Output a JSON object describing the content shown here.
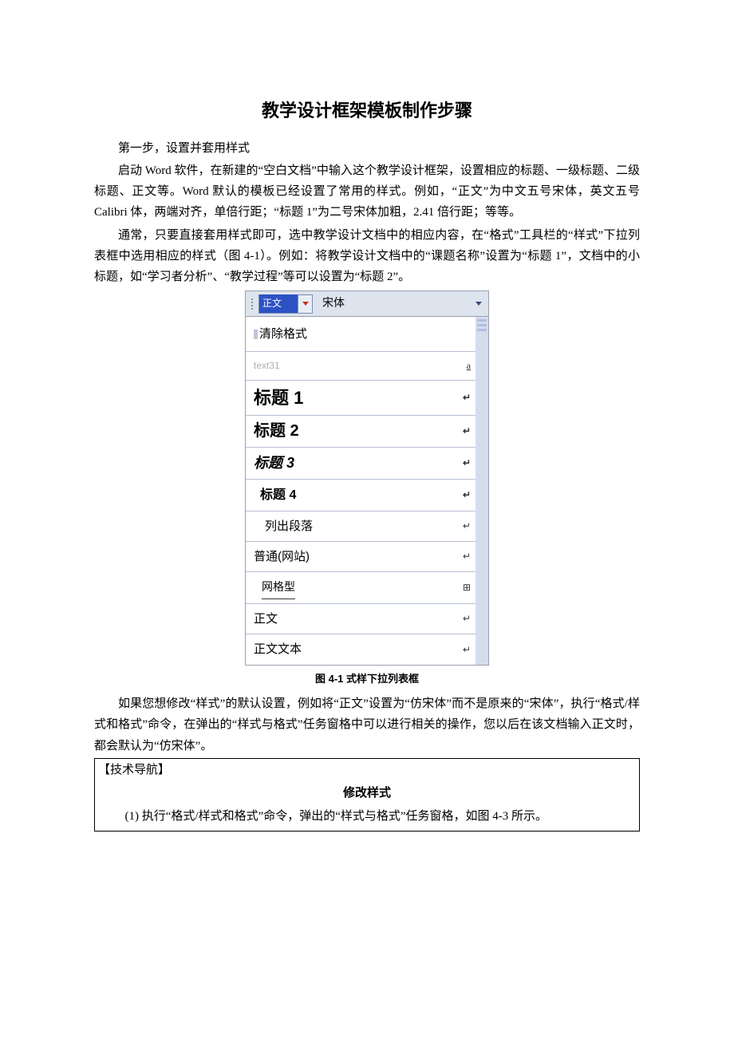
{
  "title": "教学设计框架模板制作步骤",
  "step1_label": "第一步，设置并套用样式",
  "para1": "启动 Word 软件，在新建的“空白文档”中输入这个教学设计框架，设置相应的标题、一级标题、二级标题、正文等。Word 默认的模板已经设置了常用的样式。例如，“正文”为中文五号宋体，英文五号 Calibri 体，两端对齐，单倍行距；“标题 1”为二号宋体加粗，2.41 倍行距；等等。",
  "para2": "通常，只要直接套用样式即可，选中教学设计文档中的相应内容，在“格式”工具栏的“样式”下拉列表框中选用相应的样式（图 4-1）。例如：将教学设计文档中的“课题名称”设置为“标题 1”，文档中的小标题，如“学习者分析”、“教学过程”等可以设置为“标题 2”。",
  "figure": {
    "toolbar": {
      "selected_style": "正文",
      "font_label": "宋体"
    },
    "items": {
      "clear": "清除格式",
      "text31": "text31",
      "text31_mark": "a",
      "h1": "标题 1",
      "h2": "标题 2",
      "h3": "标题 3",
      "h4": "标题 4",
      "list": "列出段落",
      "web": "普通(网站)",
      "grid": "网格型",
      "body": "正文",
      "bodytext": "正文文本"
    },
    "para_mark": "↵",
    "grid_mark": "⊞",
    "caption": "图 4-1  式样下拉列表框"
  },
  "para3": "如果您想修改“样式”的默认设置，例如将“正文”设置为“仿宋体”而不是原来的“宋体”，执行“格式/样式和格式”命令，在弹出的“样式与格式”任务窗格中可以进行相关的操作，您以后在该文档输入正文时，都会默认为“仿宋体”。",
  "techbox": {
    "header": "【技术导航】",
    "title": "修改样式",
    "step": "(1) 执行“格式/样式和格式”命令，弹出的“样式与格式”任务窗格，如图 4-3 所示。"
  }
}
